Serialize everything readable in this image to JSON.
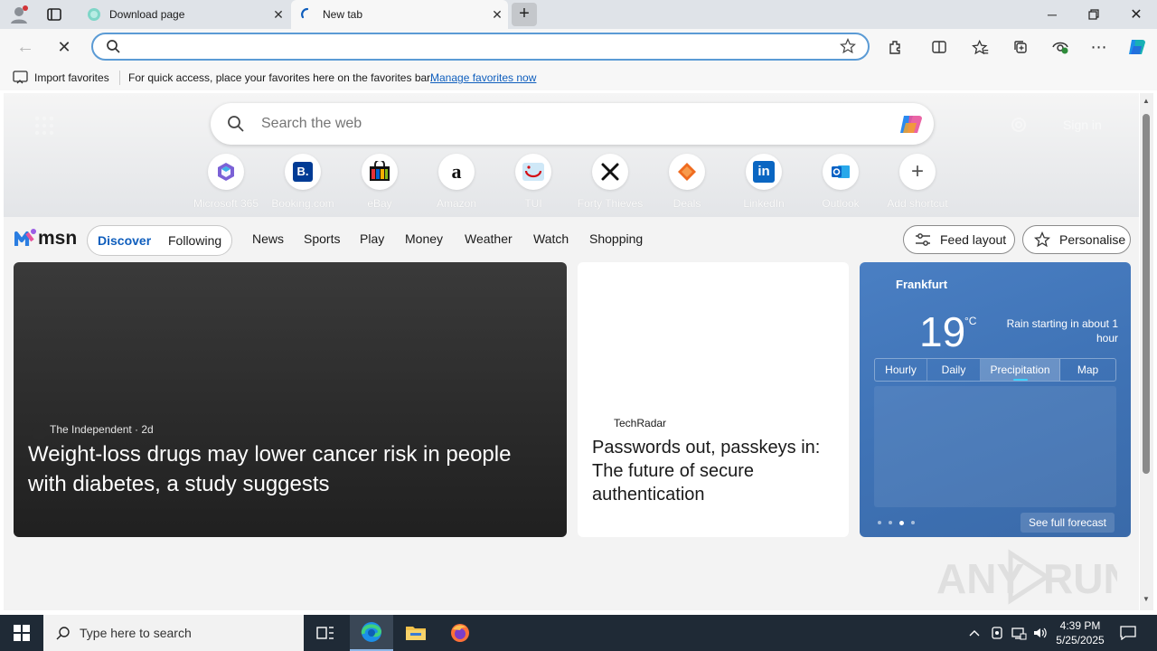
{
  "browser": {
    "tabs": [
      {
        "title": "Download page",
        "active": false
      },
      {
        "title": "New tab",
        "active": true
      }
    ],
    "address_bar": {
      "value": "",
      "placeholder": ""
    }
  },
  "favorites_bar": {
    "import_label": "Import favorites",
    "hint": "For quick access, place your favorites here on the favorites bar.",
    "manage_link": "Manage favorites now"
  },
  "new_tab": {
    "search_placeholder": "Search the web",
    "sign_in": "Sign in",
    "shortcuts": [
      {
        "label": "Microsoft 365",
        "icon": "microsoft-365-icon"
      },
      {
        "label": "Booking.com",
        "icon": "booking-icon"
      },
      {
        "label": "eBay",
        "icon": "ebay-icon"
      },
      {
        "label": "Amazon",
        "icon": "amazon-icon"
      },
      {
        "label": "TUI",
        "icon": "tui-icon"
      },
      {
        "label": "Forty Thieves",
        "icon": "forty-thieves-icon"
      },
      {
        "label": "Deals",
        "icon": "deals-icon"
      },
      {
        "label": "LinkedIn",
        "icon": "linkedin-icon"
      },
      {
        "label": "Outlook",
        "icon": "outlook-icon"
      },
      {
        "label": "Add shortcut",
        "icon": "plus-icon"
      }
    ]
  },
  "msn": {
    "logo": "msn",
    "toggle": [
      "Discover",
      "Following"
    ],
    "nav": [
      "News",
      "Sports",
      "Play",
      "Money",
      "Weather",
      "Watch",
      "Shopping"
    ],
    "feed_layout": "Feed layout",
    "personalise": "Personalise"
  },
  "cards": {
    "main": {
      "source": "The Independent",
      "age": "· 2d",
      "headline": "Weight-loss drugs may lower cancer risk in people with diabetes, a study suggests"
    },
    "secondary": {
      "source": "TechRadar",
      "headline": "Passwords out, passkeys in: The future of secure authentication"
    },
    "weather": {
      "city": "Frankfurt",
      "temp": "19",
      "unit": "°C",
      "summary": "Rain starting in about 1 hour",
      "tabs": [
        "Hourly",
        "Daily",
        "Precipitation",
        "Map"
      ],
      "active_tab": "Precipitation",
      "forecast_link": "See full forecast"
    }
  },
  "taskbar": {
    "search_placeholder": "Type here to search",
    "time": "4:39 PM",
    "date": "5/25/2025"
  },
  "colors": {
    "accent": "#0f5ebd",
    "weather_card": "#4478bb",
    "taskbar": "#1f2a36"
  }
}
